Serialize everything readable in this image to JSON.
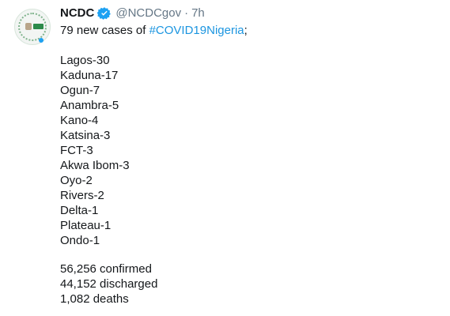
{
  "tweet": {
    "author_name": "NCDC",
    "handle": "@NCDCgov",
    "separator": "·",
    "time": "7h",
    "intro": "79 new cases of",
    "hashtag": "#COVID19Nigeria",
    "intro_suffix": ";",
    "states": [
      "Lagos-30",
      "Kaduna-17",
      "Ogun-7",
      "Anambra-5",
      "Kano-4",
      "Katsina-3",
      "FCT-3",
      "Akwa Ibom-3",
      "Oyo-2",
      "Rivers-2",
      "Delta-1",
      "Plateau-1",
      "Ondo-1"
    ],
    "totals": [
      "56,256 confirmed",
      "44,152 discharged",
      "1,082 deaths"
    ]
  },
  "icons": {
    "verified": "verified-badge-icon",
    "avatar": "ncdc-logo"
  },
  "colors": {
    "link": "#1b95e0",
    "verified": "#1da1f2",
    "muted": "#657786",
    "text": "#14171a"
  }
}
